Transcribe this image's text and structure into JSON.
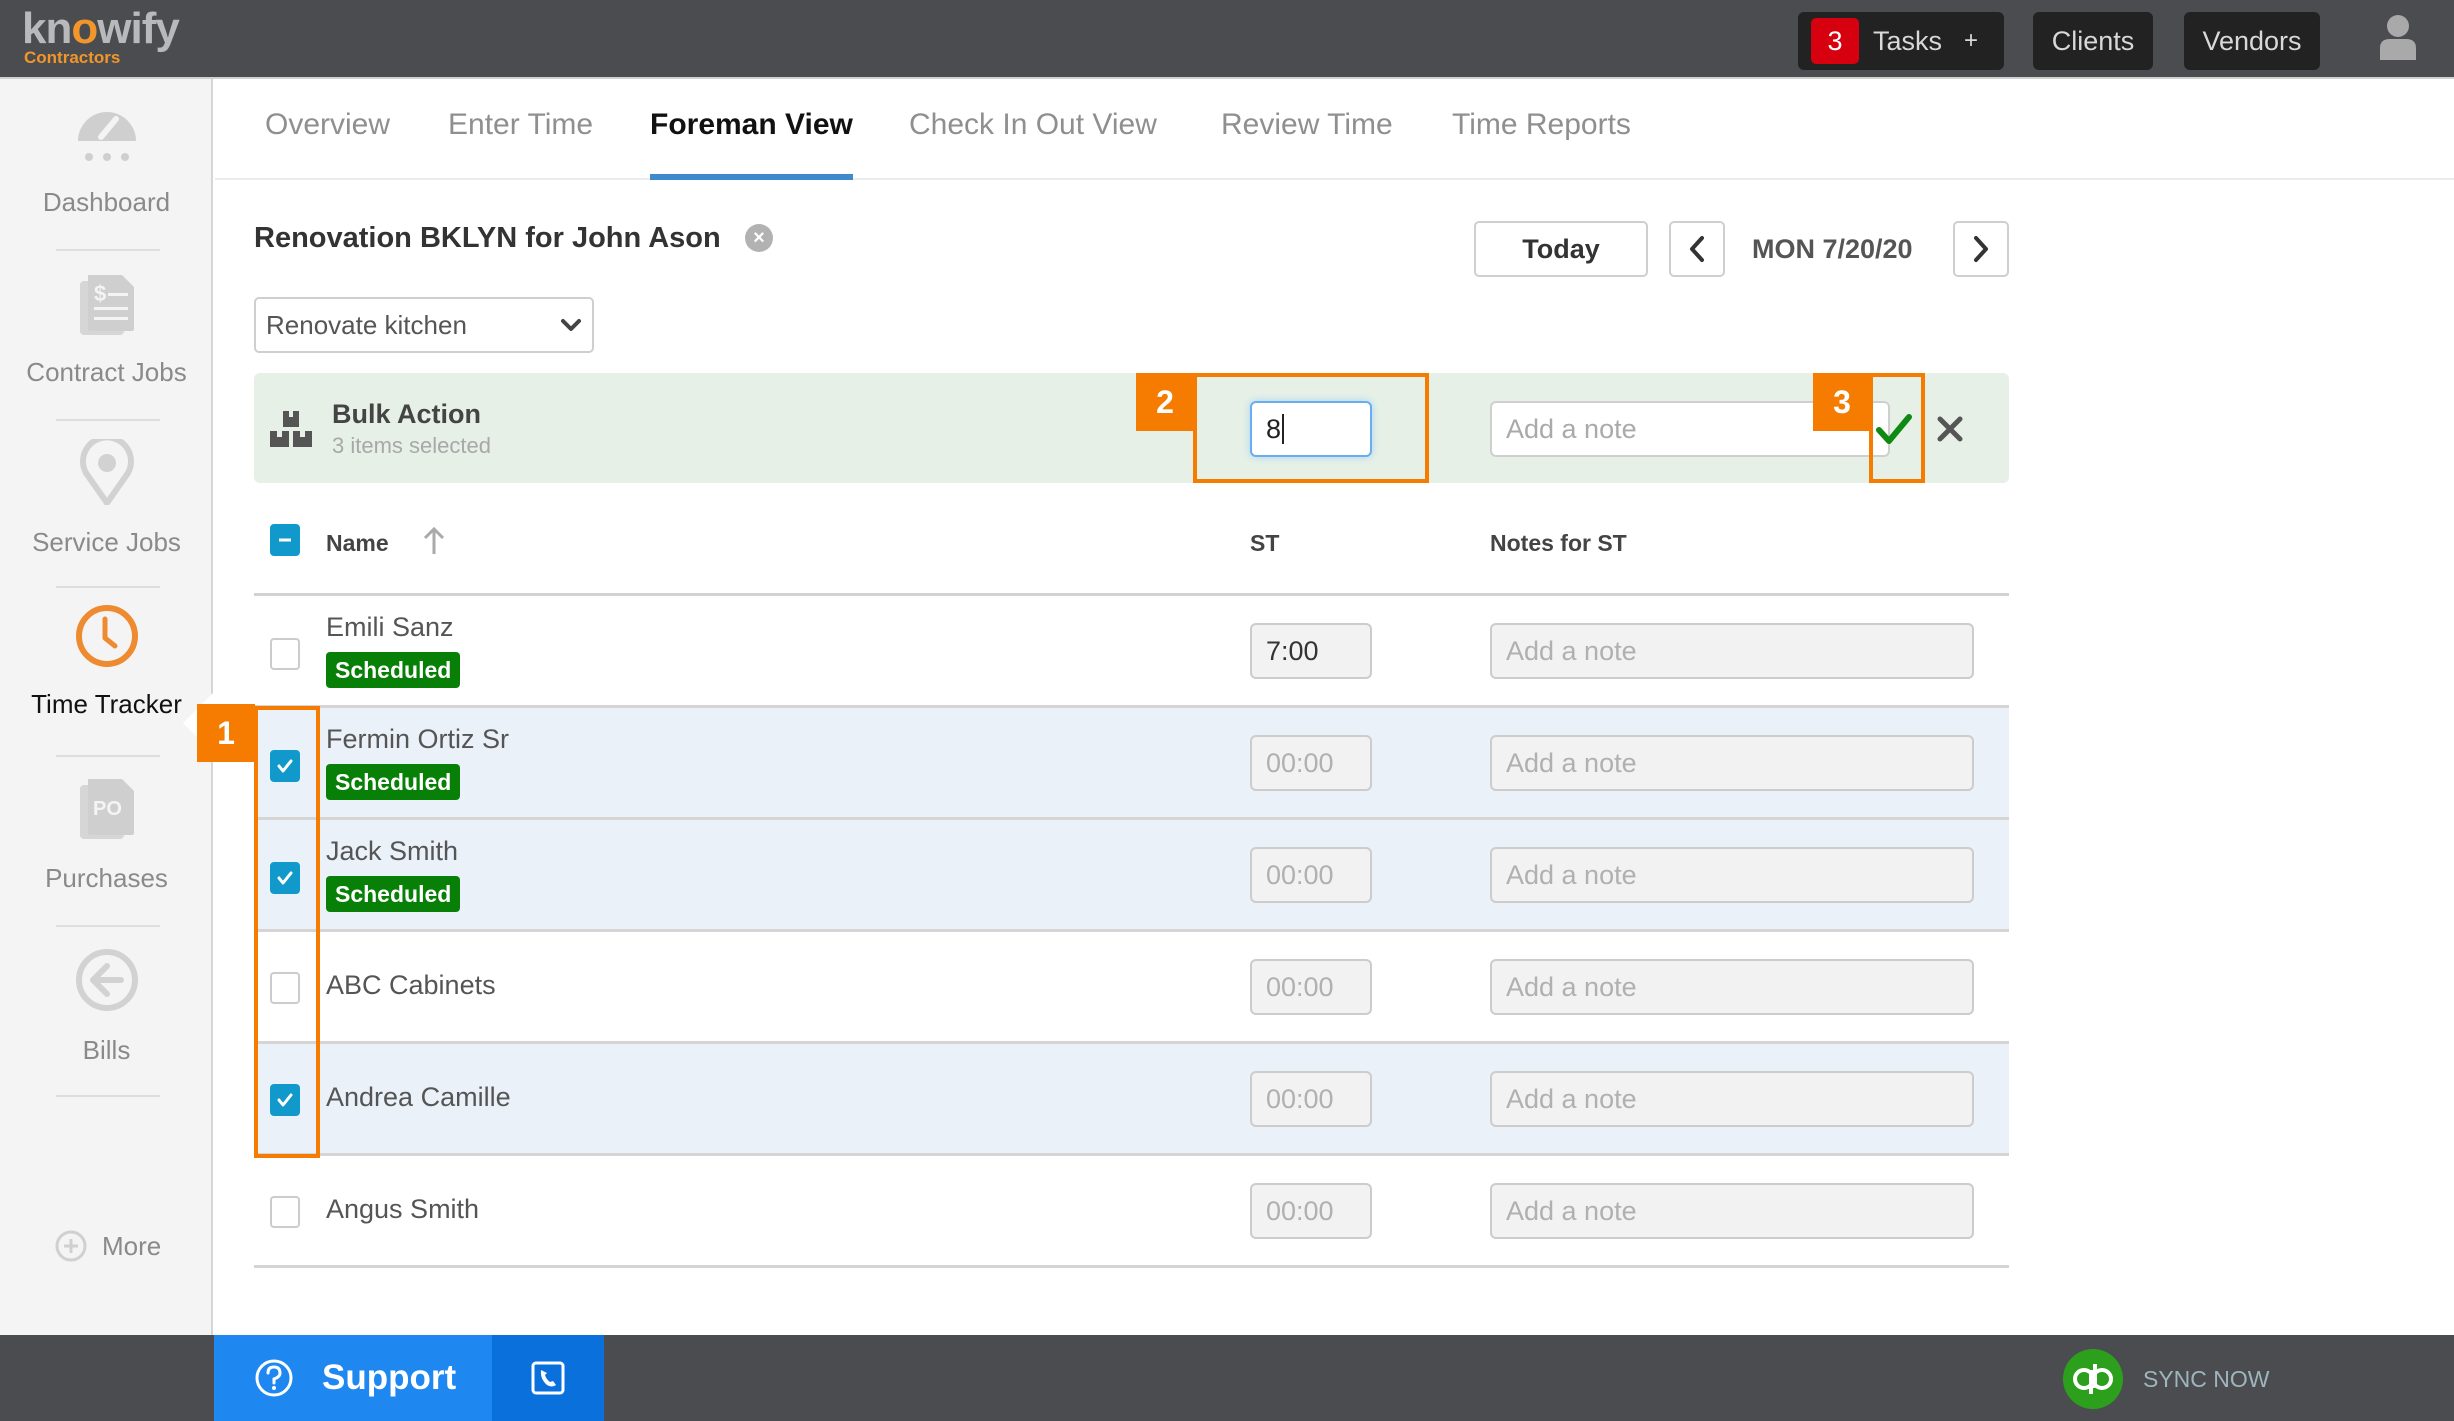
{
  "topbar": {
    "logo_main": "knowify",
    "logo_sub": "Contractors",
    "tasks_count": "3",
    "tasks_label": "Tasks",
    "tasks_add": "+",
    "clients_label": "Clients",
    "vendors_label": "Vendors"
  },
  "sidebar": {
    "items": [
      {
        "label": "Dashboard",
        "icon": "dashboard-gauge-icon"
      },
      {
        "label": "Contract Jobs",
        "icon": "contract-document-icon"
      },
      {
        "label": "Service Jobs",
        "icon": "location-pin-icon"
      },
      {
        "label": "Time Tracker",
        "icon": "clock-icon",
        "active": true
      },
      {
        "label": "Purchases",
        "icon": "purchase-order-icon"
      },
      {
        "label": "Bills",
        "icon": "arrow-left-circle-icon"
      }
    ],
    "more_label": "More"
  },
  "tabs": [
    {
      "label": "Overview"
    },
    {
      "label": "Enter Time"
    },
    {
      "label": "Foreman View",
      "active": true
    },
    {
      "label": "Check In Out View"
    },
    {
      "label": "Review Time"
    },
    {
      "label": "Time Reports"
    }
  ],
  "page": {
    "title": "Renovation BKLYN for John Ason",
    "task_select_value": "Renovate kitchen",
    "today_label": "Today",
    "date_label": "MON 7/20/20"
  },
  "bulk": {
    "title": "Bulk Action",
    "subtitle": "3 items selected",
    "st_value": "8",
    "note_placeholder": "Add a note"
  },
  "annotations": [
    "1",
    "2",
    "3"
  ],
  "table": {
    "headers": {
      "name": "Name",
      "st": "ST",
      "notes": "Notes for ST"
    },
    "rows": [
      {
        "name": "Emili Sanz",
        "badge": "Scheduled",
        "checked": false,
        "st": "7:00",
        "st_filled": true,
        "note_placeholder": "Add a note"
      },
      {
        "name": "Fermin Ortiz Sr",
        "badge": "Scheduled",
        "checked": true,
        "st": "00:00",
        "st_filled": false,
        "note_placeholder": "Add a note"
      },
      {
        "name": "Jack Smith",
        "badge": "Scheduled",
        "checked": true,
        "st": "00:00",
        "st_filled": false,
        "note_placeholder": "Add a note"
      },
      {
        "name": "ABC Cabinets",
        "badge": null,
        "checked": false,
        "st": "00:00",
        "st_filled": false,
        "note_placeholder": "Add a note"
      },
      {
        "name": "Andrea Camille",
        "badge": null,
        "checked": true,
        "st": "00:00",
        "st_filled": false,
        "note_placeholder": "Add a note"
      },
      {
        "name": "Angus Smith",
        "badge": null,
        "checked": false,
        "st": "00:00",
        "st_filled": false,
        "note_placeholder": "Add a note"
      }
    ]
  },
  "footer": {
    "support_label": "Support",
    "sync_label": "SYNC NOW"
  },
  "colors": {
    "accent_orange": "#f57c00",
    "brand_orange": "#f0962a",
    "checkbox_blue": "#1199cc",
    "scheduled_green": "#088008",
    "tab_underline": "#3d8bcd",
    "support_blue": "#1e88f0",
    "tasks_badge_red": "#d6000f"
  }
}
